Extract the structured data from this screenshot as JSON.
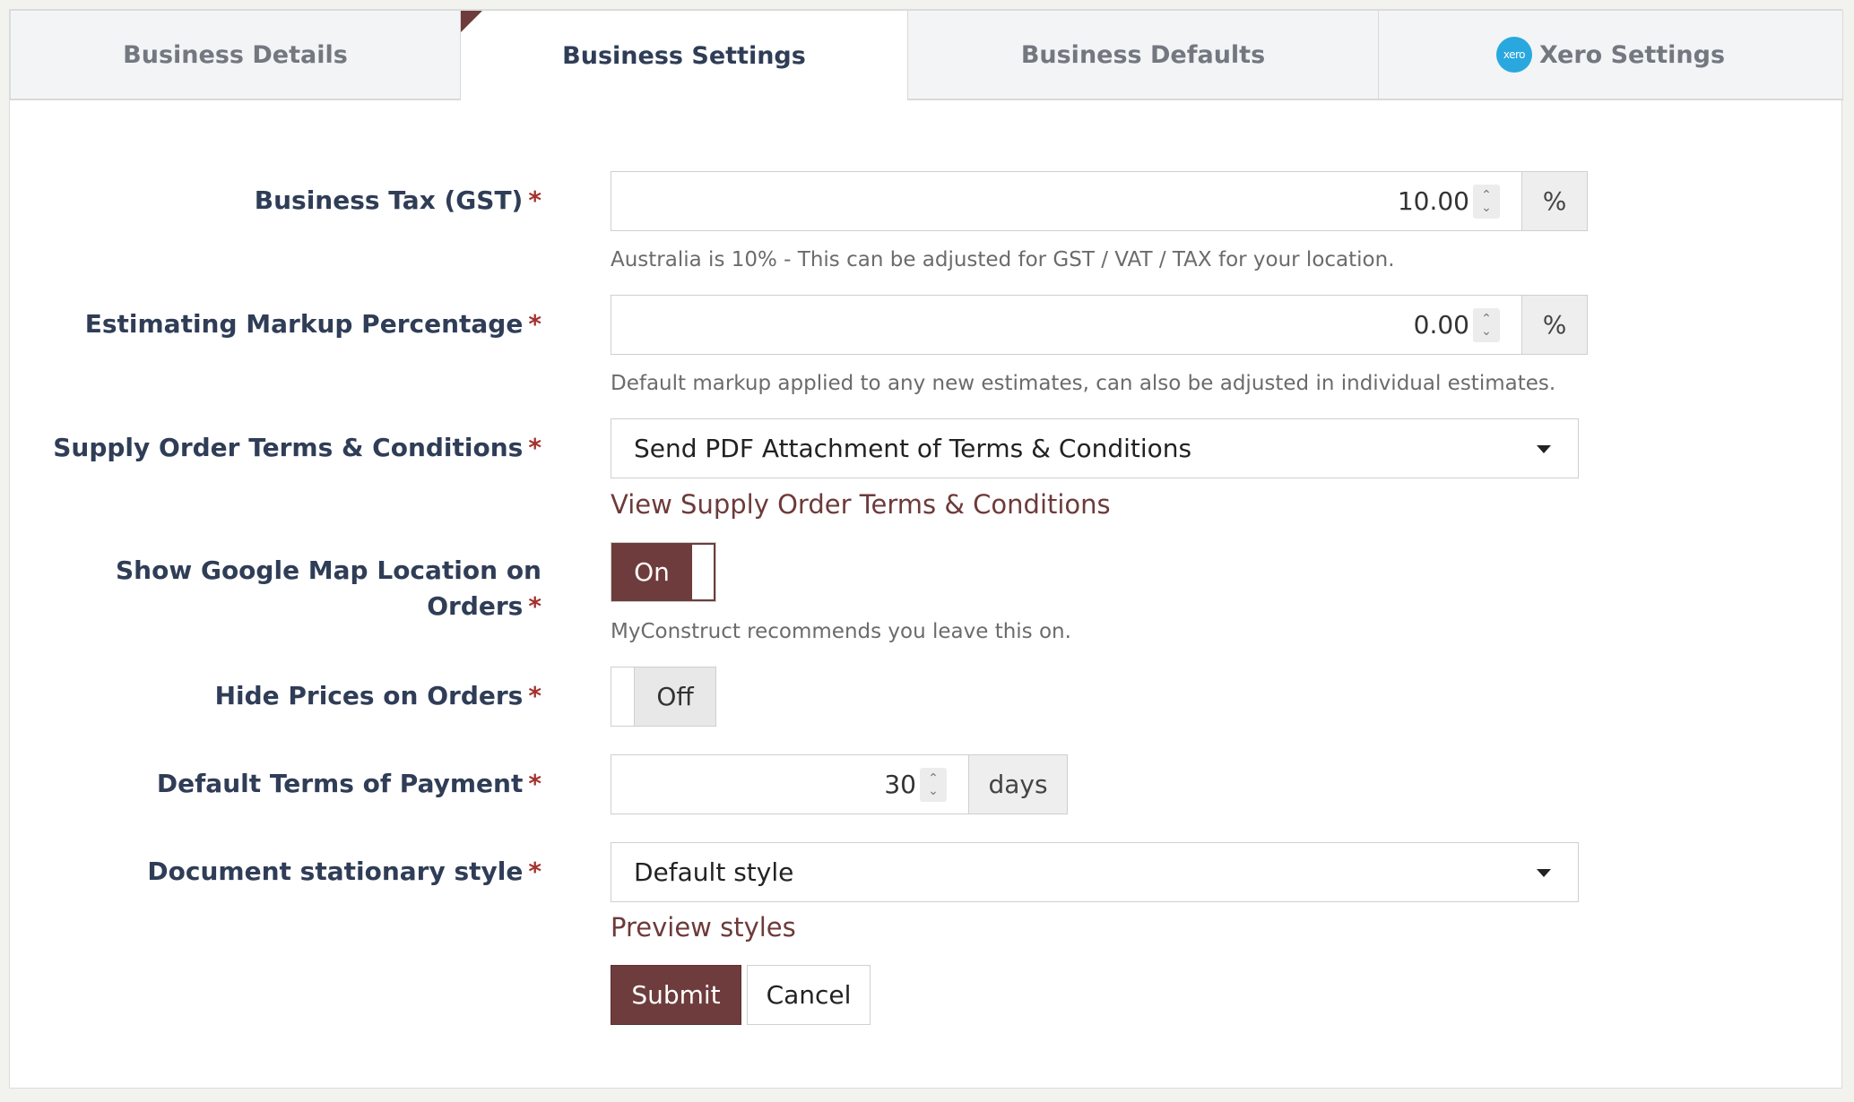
{
  "tabs": [
    {
      "label": "Business Details"
    },
    {
      "label": "Business Settings"
    },
    {
      "label": "Business Defaults"
    },
    {
      "label": "Xero Settings",
      "logo_text": "xero"
    }
  ],
  "active_tab": "Business Settings",
  "required_mark": "*",
  "fields": {
    "tax": {
      "label": "Business Tax (GST)",
      "value": "10.00",
      "addon": "%",
      "help": "Australia is 10% - This can be adjusted for GST / VAT / TAX for your location."
    },
    "markup": {
      "label": "Estimating Markup Percentage",
      "value": "0.00",
      "addon": "%",
      "help": "Default markup applied to any new estimates, can also be adjusted in individual estimates."
    },
    "supply_terms": {
      "label": "Supply Order Terms & Conditions",
      "selected": "Send PDF Attachment of Terms & Conditions",
      "link": "View Supply Order Terms & Conditions"
    },
    "google_map": {
      "label_line1": "Show Google Map Location on",
      "label_line2": "Orders",
      "toggle": "On",
      "help": "MyConstruct recommends you leave this on."
    },
    "hide_prices": {
      "label": "Hide Prices on Orders",
      "toggle": "Off"
    },
    "payment_terms": {
      "label": "Default Terms of Payment",
      "value": "30",
      "addon": "days"
    },
    "stationary": {
      "label": "Document stationary style",
      "selected": "Default style",
      "link": "Preview styles"
    }
  },
  "buttons": {
    "submit": "Submit",
    "cancel": "Cancel"
  },
  "colors": {
    "brand": "#6e3c3c",
    "label": "#2f3d57",
    "required": "#a3322f",
    "xero": "#29a8df"
  }
}
